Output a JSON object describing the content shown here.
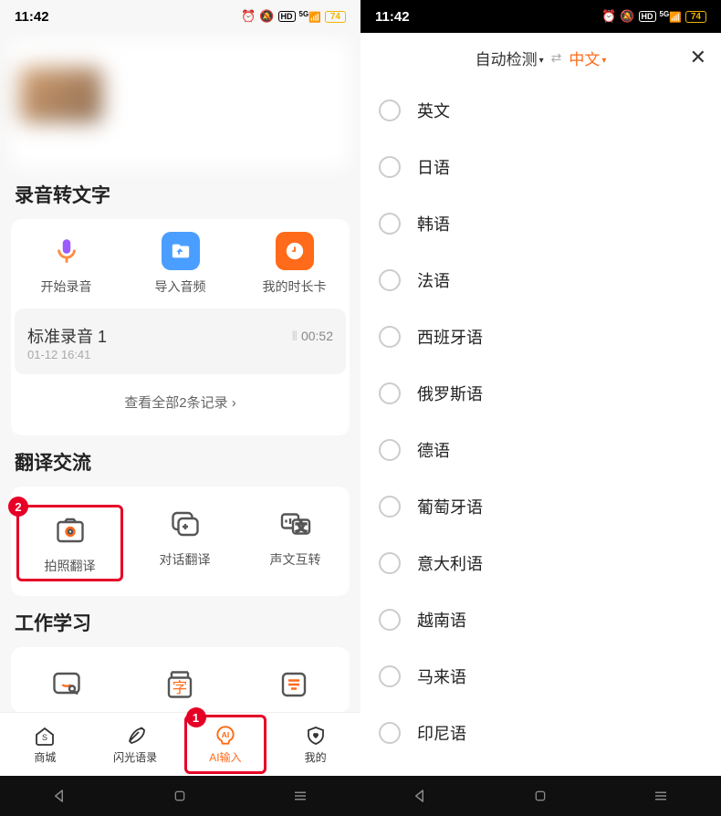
{
  "status": {
    "time": "11:42",
    "battery": "74"
  },
  "left": {
    "section_audio_title": "录音转文字",
    "actions": {
      "record": "开始录音",
      "import": "导入音频",
      "timecard": "我的时长卡"
    },
    "record_item": {
      "title": "标准录音 1",
      "duration": "00:52",
      "timestamp": "01-12 16:41"
    },
    "view_all": "查看全部2条记录",
    "section_translate_title": "翻译交流",
    "translate": {
      "photo": "拍照翻译",
      "dialog": "对话翻译",
      "voice_text": "声文互转"
    },
    "section_work_title": "工作学习",
    "bottom_nav": {
      "mall": "商城",
      "quotes": "闪光语录",
      "ai_input": "AI输入",
      "mine": "我的"
    }
  },
  "right": {
    "source_lang": "自动检测",
    "target_lang": "中文",
    "languages": [
      "英文",
      "日语",
      "韩语",
      "法语",
      "西班牙语",
      "俄罗斯语",
      "德语",
      "葡萄牙语",
      "意大利语",
      "越南语",
      "马来语",
      "印尼语"
    ]
  }
}
